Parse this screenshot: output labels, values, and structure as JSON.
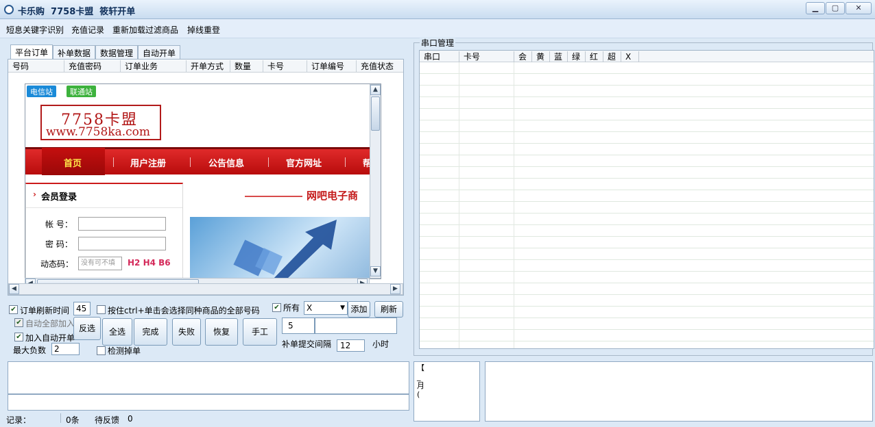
{
  "window": {
    "title": "卡乐购  7758卡盟  筱轩开单"
  },
  "menu": [
    "短息关键字识别",
    "充值记录",
    "重新加载过滤商品",
    "掉线重登"
  ],
  "tabs": [
    "平台订单",
    "补单数据",
    "数据管理",
    "自动开单"
  ],
  "order_table": {
    "columns": [
      "号码",
      "充值密码",
      "订单业务",
      "开单方式",
      "数量",
      "卡号",
      "订单编号",
      "充值状态"
    ]
  },
  "browser": {
    "stations": [
      "电信站",
      "联通站"
    ],
    "logo": {
      "main": "7758卡盟",
      "url": "www.7758ka.com"
    },
    "nav": [
      "首页",
      "用户注册",
      "公告信息",
      "官方网址",
      "帮"
    ],
    "login": {
      "title": "会员登录",
      "account_label": "帐 号：",
      "password_label": "密 码：",
      "dynamic_label": "动态码：",
      "dynamic_placeholder": "没有可不填",
      "dynamic_hint": "H2 H4 B6"
    },
    "banner_text": "网吧电子商"
  },
  "controls": {
    "refresh_time_label": "订单刷新时间",
    "refresh_time_value": "45",
    "ctrl_select_label": "按住ctrl+单击会选择同种商品的全部号码",
    "all_label": "所有",
    "select_value": "X",
    "add_button": "添加",
    "refresh_button": "刷新",
    "auto_add_all": "自动全部加入",
    "join_auto_open": "加入自动开单",
    "max_neg_label": "最大负数",
    "max_neg_value": "2",
    "detect_drop": "检测掉单",
    "buttons": [
      "反选",
      "全选",
      "完成",
      "失败",
      "恢复",
      "手工"
    ],
    "field_5": "5",
    "resubmit_label": "补单提交间隔",
    "resubmit_value": "12",
    "hour_label": "小时"
  },
  "serial": {
    "legend": "串口管理",
    "columns": [
      "串口",
      "卡号",
      "会",
      "黄",
      "蓝",
      "绿",
      "红",
      "超",
      "X"
    ]
  },
  "bottom_mid_text": [
    "【",
    "_",
    "月",
    "("
  ],
  "status": {
    "record_label": "记录：",
    "count": "0条",
    "pending_label": "待反馈",
    "pending_value": "0"
  }
}
